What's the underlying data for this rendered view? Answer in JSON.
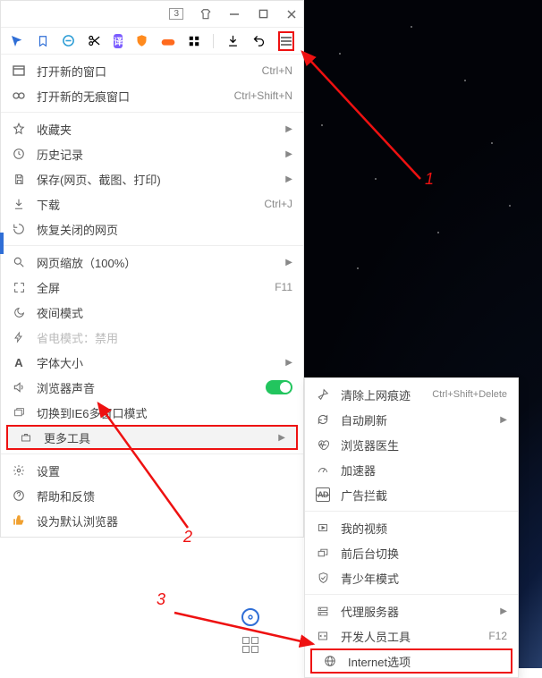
{
  "titlebar": {
    "badge": "3"
  },
  "menu": {
    "new_window": "打开新的窗口",
    "new_window_sc": "Ctrl+N",
    "new_incognito": "打开新的无痕窗口",
    "new_incognito_sc": "Ctrl+Shift+N",
    "favorites": "收藏夹",
    "history": "历史记录",
    "save": "保存(网页、截图、打印)",
    "downloads": "下载",
    "downloads_sc": "Ctrl+J",
    "reopen_closed": "恢复关闭的网页",
    "zoom": "网页缩放（100%）",
    "fullscreen": "全屏",
    "fullscreen_sc": "F11",
    "night_mode": "夜间模式",
    "power_save": "省电模式：禁用",
    "font_size": "字体大小",
    "browser_sound": "浏览器声音",
    "switch_ie6": "切换到IE6多窗口模式",
    "more_tools": "更多工具",
    "settings": "设置",
    "help_feedback": "帮助和反馈",
    "set_default": "设为默认浏览器"
  },
  "submenu": {
    "clear_data": "清除上网痕迹",
    "clear_data_sc": "Ctrl+Shift+Delete",
    "auto_refresh": "自动刷新",
    "browser_doctor": "浏览器医生",
    "accelerator": "加速器",
    "ad_block": "广告拦截",
    "my_videos": "我的视频",
    "fg_bg_switch": "前后台切换",
    "teen_mode": "青少年模式",
    "proxy_server": "代理服务器",
    "dev_tools": "开发人员工具",
    "dev_tools_sc": "F12",
    "internet_options": "Internet选项"
  },
  "annotations": {
    "a1": "1",
    "a2": "2",
    "a3": "3"
  },
  "colors": {
    "highlight": "#e11",
    "accent": "#2f6ed6",
    "toggle_on": "#22c55e"
  }
}
